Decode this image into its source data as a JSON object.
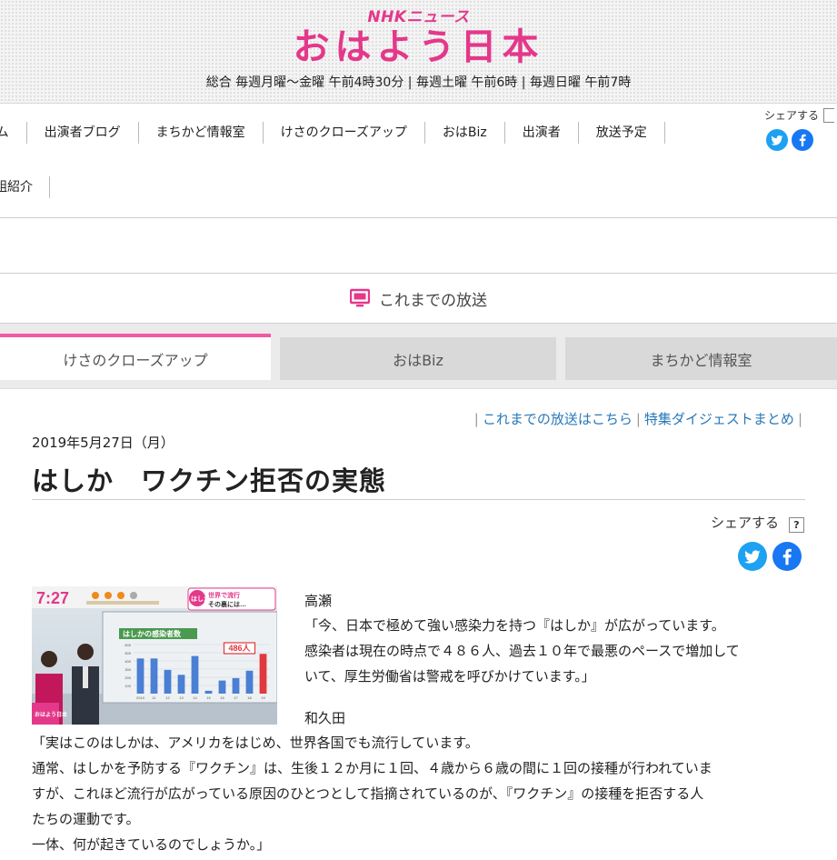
{
  "header": {
    "brand_sub": "NHKニュース",
    "brand_main": "おはよう日本",
    "schedule": "総合 毎週月曜～金曜 午前4時30分 | 毎週土曜 午前6時 | 毎週日曜 午前7時",
    "accent_color": "#e4388a"
  },
  "nav": {
    "row1": [
      "ーム",
      "出演者ブログ",
      "まちかど情報室",
      "けさのクローズアップ",
      "おはBiz",
      "出演者",
      "放送予定"
    ],
    "row2": [
      "組紹介"
    ],
    "share_label": "シェアする"
  },
  "past_broadcasts": {
    "label": "これまでの放送",
    "icon": "tv-icon"
  },
  "tabs": [
    {
      "label": "けさのクローズアップ",
      "active": true
    },
    {
      "label": "おはBiz",
      "active": false
    },
    {
      "label": "まちかど情報室",
      "active": false
    }
  ],
  "article": {
    "links": [
      "これまでの放送はこちら",
      "特集ダイジェストまとめ"
    ],
    "date": "2019年5月27日（月）",
    "title": "はしか　ワクチン拒否の実態",
    "share_label": "シェアする",
    "help": "?",
    "image": {
      "clock": "7:27",
      "badge": "はしか",
      "caption1": "世界で流行",
      "caption2": "その裏には…",
      "chart_title": "はしかの感染者数",
      "highlight_value": "486人",
      "corner_logo": "おはよう日本"
    },
    "speaker1": "高瀬",
    "para1": [
      "「今、日本で極めて強い感染力を持つ『はしか』が広がっています。",
      "感染者は現在の時点で４８６人、過去１０年で最悪のペースで増加して",
      "いて、厚生労働省は警戒を呼びかけています。」"
    ],
    "speaker2": "和久田",
    "para2": [
      "「実はこのはしかは、アメリカをはじめ、世界各国でも流行しています。",
      "通常、はしかを予防する『ワクチン』は、生後１２か月に１回、４歳から６歳の間に１回の接種が行われていま",
      "すが、これほど流行が広がっている原因のひとつとして指摘されているのが、『ワクチン』の接種を拒否する人",
      "たちの運動です。",
      "一体、何が起きているのでしょうか。」"
    ]
  },
  "chart_data": {
    "type": "bar",
    "title": "はしかの感染者数",
    "categories": [
      "2010",
      "11",
      "12",
      "13",
      "14",
      "15",
      "16",
      "17",
      "18",
      "19"
    ],
    "values": [
      430,
      430,
      290,
      230,
      460,
      35,
      160,
      190,
      280,
      486
    ],
    "ylim": [
      0,
      600
    ],
    "yticks": [
      100,
      200,
      300,
      400,
      500,
      600
    ],
    "annotation": "486人",
    "colors": {
      "bars": "#4a7fd4",
      "highlight": "#e0393e"
    }
  }
}
